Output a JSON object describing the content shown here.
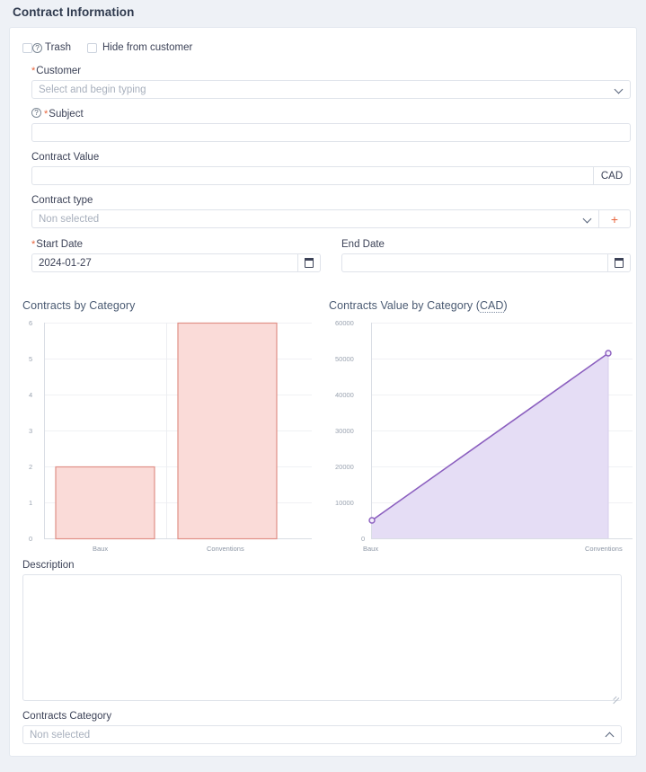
{
  "page": {
    "title": "Contract Information",
    "background_color": "#eef1f6",
    "card_color": "#ffffff"
  },
  "form": {
    "checkboxes": [
      {
        "label": "Trash",
        "has_help_icon": true,
        "checked": false
      },
      {
        "label": "Hide from customer",
        "has_help_icon": false,
        "checked": false
      }
    ],
    "customer": {
      "label": "Customer",
      "required": true,
      "placeholder": "Select and begin typing",
      "value": "",
      "icon": "chevron-down-icon"
    },
    "subject": {
      "label": "Subject",
      "required": true,
      "has_help_icon": true,
      "placeholder": "",
      "value": ""
    },
    "contract_value": {
      "label": "Contract Value",
      "required": false,
      "placeholder": "",
      "value": "",
      "currency": "CAD"
    },
    "contract_type": {
      "label": "Contract type",
      "required": false,
      "placeholder": "Non selected",
      "value": "",
      "icon": "chevron-down-icon",
      "add_button_label": "+",
      "add_button_color": "#e8633a"
    },
    "start_date": {
      "label": "Start Date",
      "required": true,
      "value": "2024-01-27",
      "icon": "calendar-icon"
    },
    "end_date": {
      "label": "End Date",
      "required": false,
      "value": "",
      "icon": "calendar-icon"
    },
    "description": {
      "label": "Description",
      "value": "",
      "placeholder": ""
    },
    "contracts_category": {
      "label": "Contracts Category",
      "placeholder": "Non selected",
      "value": "",
      "icon": "chevron-up-icon"
    }
  },
  "chart_data": [
    {
      "type": "bar",
      "title": "Contracts by Category",
      "categories": [
        "Baux",
        "Conventions"
      ],
      "values": [
        2,
        6
      ],
      "xlabel": "",
      "ylabel": "",
      "ylim": [
        0,
        6
      ],
      "yticks": [
        0,
        1,
        2,
        3,
        4,
        5,
        6
      ],
      "ytick_labels": [
        "0",
        "1",
        "2",
        "3",
        "4",
        "5",
        "6"
      ],
      "grid": true,
      "legend": "none",
      "bar_fill": "#fadbd8",
      "bar_stroke": "#e08f87"
    },
    {
      "type": "area",
      "title": "Contracts Value by Category (CAD)",
      "title_abbr": "CAD",
      "categories": [
        "Baux",
        "Conventions"
      ],
      "values": [
        5000,
        51500
      ],
      "xlabel": "",
      "ylabel": "",
      "ylim": [
        0,
        60000
      ],
      "yticks": [
        0,
        10000,
        20000,
        30000,
        40000,
        50000,
        60000
      ],
      "ytick_labels": [
        "0",
        "10000",
        "20000",
        "30000",
        "40000",
        "50000",
        "60000"
      ],
      "grid": true,
      "legend": "none",
      "area_fill": "#e5ddf5",
      "line_stroke": "#8b5fbf",
      "marker": "circle"
    }
  ]
}
